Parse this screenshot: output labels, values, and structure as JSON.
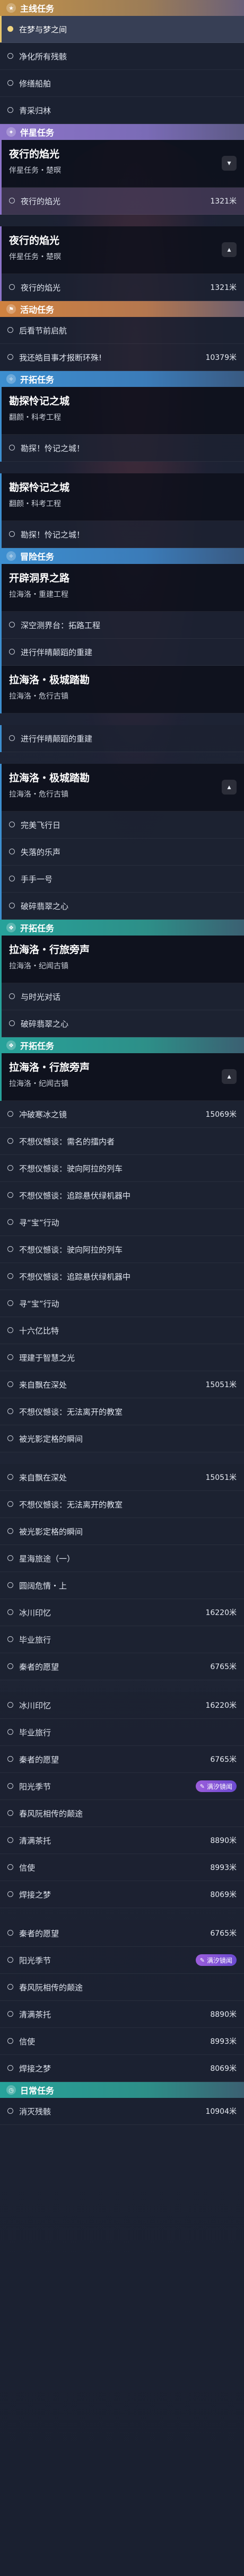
{
  "sections": {
    "main": "主线任务",
    "companion": "伴星任务",
    "event": "活动任务",
    "trailblaze": "开拓任务",
    "adventure": "冒险任务",
    "daily": "日常任务"
  },
  "main_items": [
    "在梦与梦之间",
    "净化所有残骸",
    "修缮船舶",
    "青采归林"
  ],
  "companion": {
    "card1": {
      "title": "夜行的焰光",
      "subtitle": "伴星任务・楚暝"
    },
    "item1": {
      "label": "夜行的焰光",
      "dist": "1321米"
    },
    "card2": {
      "title": "夜行的焰光",
      "subtitle": "伴星任务・楚暝"
    },
    "item2": {
      "label": "夜行的焰光",
      "dist": "1321米"
    }
  },
  "event_items": [
    {
      "label": "后看节前启航",
      "dist": ""
    },
    {
      "label": "我还皓目事才报断环殊!",
      "dist": "10379米"
    }
  ],
  "trailblaze_card1": {
    "title": "勘探怜记之城",
    "subtitle": "翻颜・科考工程"
  },
  "trailblaze_item1": "勘探！怜记之城！",
  "trailblaze_card2": {
    "title": "勘探怜记之城",
    "subtitle": "翻颜・科考工程"
  },
  "trailblaze_item2": "勘探！怜记之城！",
  "adventure_card1": {
    "title": "开辟洞界之路",
    "subtitle": "拉海洛・重建工程"
  },
  "adventure_items1": [
    "深空测界台：拓路工程",
    "进行伴晴颠蹈的重建"
  ],
  "adventure_card2": {
    "title": "拉海洛・极城踏勘",
    "subtitle": "拉海洛・危行古镇"
  },
  "adventure_card2_item": "进行伴晴颠蹈的重建",
  "adventure_card3": {
    "title": "拉海洛・极城踏勘",
    "subtitle": "拉海洛・危行古镇"
  },
  "adventure_items3": [
    "完美飞行日",
    "失落的乐声",
    "手手一号",
    "破碎翡翠之心"
  ],
  "trail2_card1": {
    "title": "拉海洛・行旅旁声",
    "subtitle": "拉海洛・纪闻古镇"
  },
  "trail2_items1": [
    "与时光对话",
    "破碎翡翠之心"
  ],
  "trail2_card2": {
    "title": "拉海洛・行旅旁声",
    "subtitle": "拉海洛・纪闻古镇"
  },
  "list_a": [
    {
      "label": "冲破寒冰之镜",
      "dist": "15069米"
    },
    {
      "label": "不想仪憾谈：需名的擂内者",
      "dist": ""
    },
    {
      "label": "不想仪憾谈：驶向阿拉的列车",
      "dist": ""
    },
    {
      "label": "不想仪憾谈：追踪悬伏绿机器中",
      "dist": ""
    },
    {
      "label": "寻“宝”行动",
      "dist": ""
    },
    {
      "label": "不想仪憾谈：驶向阿拉的列车",
      "dist": ""
    },
    {
      "label": "不想仪憾谈：追踪悬伏绿机器中",
      "dist": ""
    },
    {
      "label": "寻“宝”行动",
      "dist": ""
    },
    {
      "label": "十六亿比特",
      "dist": ""
    },
    {
      "label": "理建于智慧之光",
      "dist": ""
    },
    {
      "label": "来自飘在深处",
      "dist": "15051米"
    },
    {
      "label": "不想仪憾谈：无法离开的教室",
      "dist": ""
    },
    {
      "label": "被光影定格的瞬间",
      "dist": ""
    }
  ],
  "list_b": [
    {
      "label": "来自飘在深处",
      "dist": "15051米"
    },
    {
      "label": "不想仪憾谈：无法离开的教室",
      "dist": ""
    },
    {
      "label": "被光影定格的瞬间",
      "dist": ""
    },
    {
      "label": "星海旅途（一）",
      "dist": ""
    },
    {
      "label": "圆阔危情・上",
      "dist": ""
    },
    {
      "label": "冰川印忆",
      "dist": "16220米"
    },
    {
      "label": "毕业旅行",
      "dist": ""
    },
    {
      "label": "秦者的愿望",
      "dist": "6765米"
    }
  ],
  "list_c": [
    {
      "label": "冰川印忆",
      "dist": "16220米"
    },
    {
      "label": "毕业旅行",
      "dist": ""
    },
    {
      "label": "秦者的愿望",
      "dist": "6765米"
    },
    {
      "label": "阳光季节",
      "dist": "",
      "badge": "满汐镜闻"
    },
    {
      "label": "春风阮相传的颠途",
      "dist": ""
    },
    {
      "label": "清满茶托",
      "dist": "8890米"
    },
    {
      "label": "信使",
      "dist": "8993米"
    },
    {
      "label": "焊接之梦",
      "dist": "8069米"
    }
  ],
  "list_d": [
    {
      "label": "秦者的愿望",
      "dist": "6765米"
    },
    {
      "label": "阳光季节",
      "dist": "",
      "badge": "满汐镜闻"
    },
    {
      "label": "春风阮相传的颠途",
      "dist": ""
    },
    {
      "label": "清满茶托",
      "dist": "8890米"
    },
    {
      "label": "信使",
      "dist": "8993米"
    },
    {
      "label": "焊接之梦",
      "dist": "8069米"
    }
  ],
  "daily_items": [
    {
      "label": "消灭残骸",
      "dist": "10904米"
    }
  ]
}
